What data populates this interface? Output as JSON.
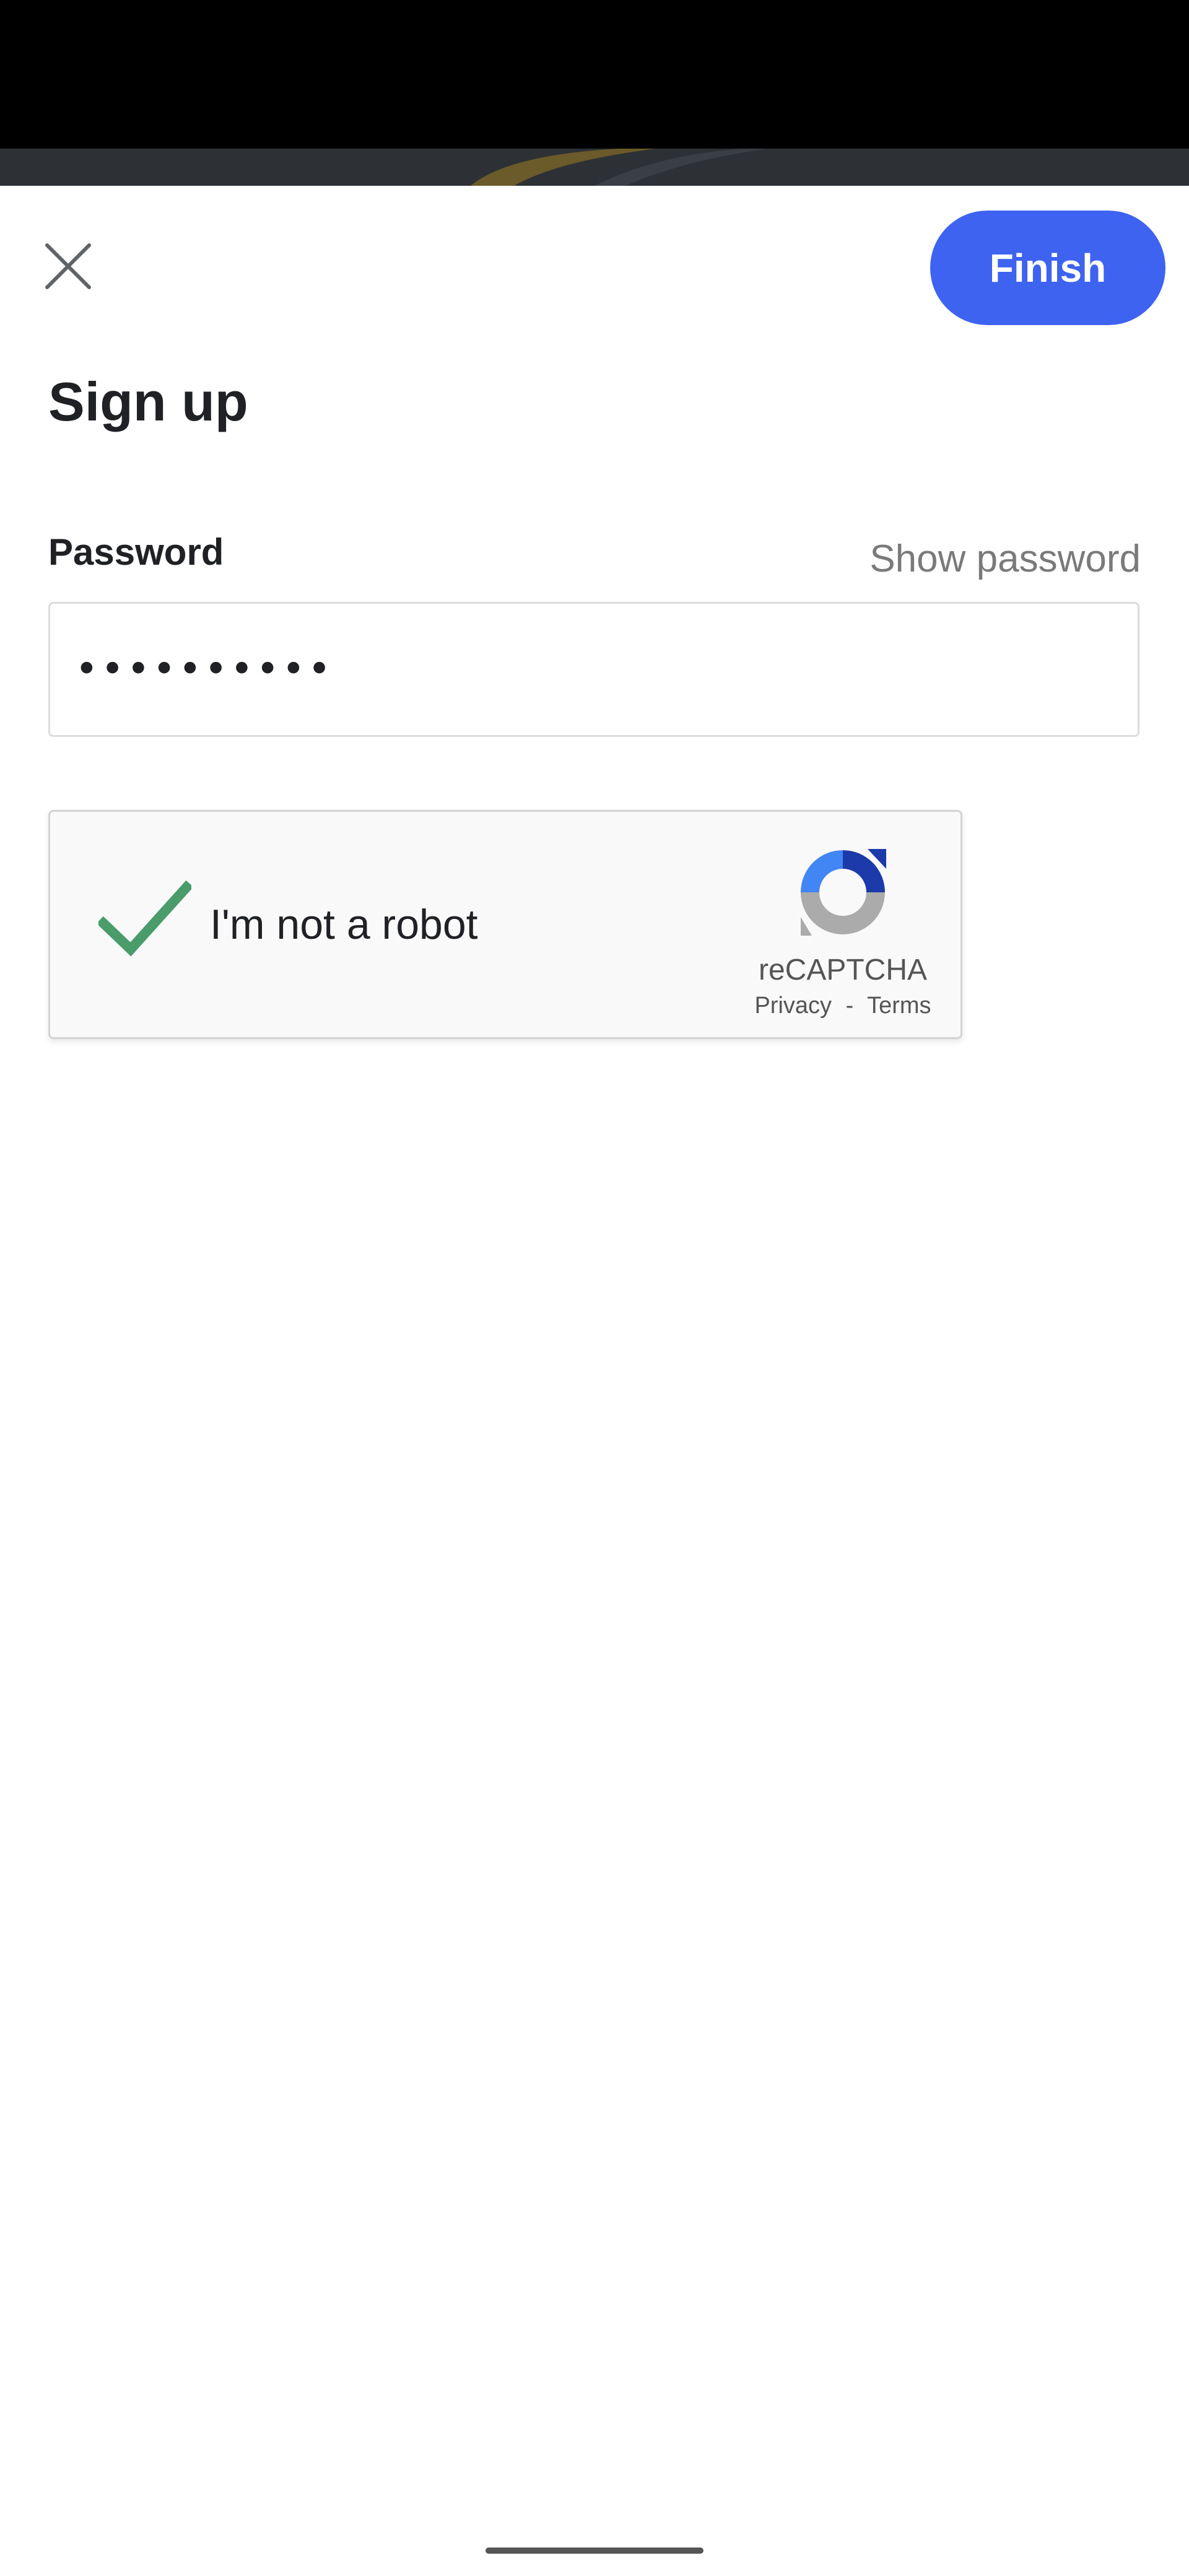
{
  "header": {
    "close_icon": "close-icon",
    "finish_label": "Finish"
  },
  "page": {
    "title": "Sign up"
  },
  "password_field": {
    "label": "Password",
    "show_password_label": "Show password",
    "value": "••••••••••"
  },
  "recaptcha": {
    "checked": true,
    "label": "I'm not a robot",
    "brand": "reCAPTCHA",
    "privacy_label": "Privacy",
    "separator": "-",
    "terms_label": "Terms"
  },
  "colors": {
    "accent": "#3d63f0",
    "check": "#4a9c6a",
    "status_bar": "#000000"
  }
}
